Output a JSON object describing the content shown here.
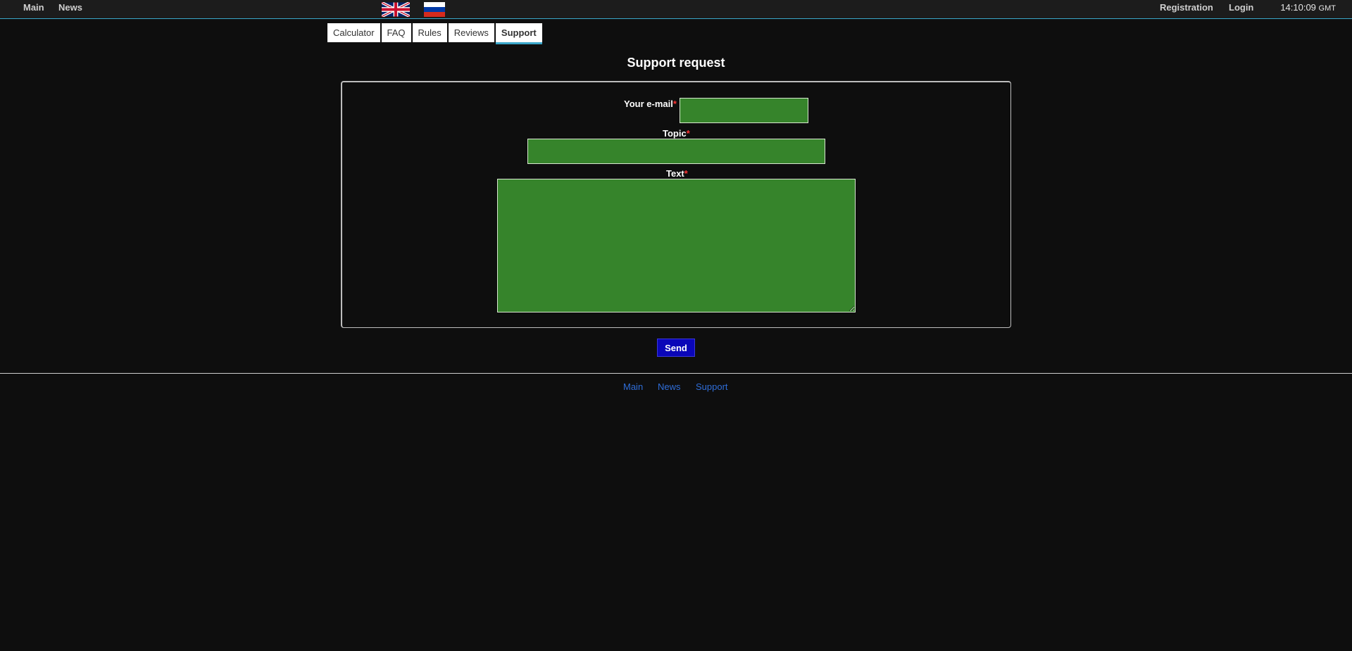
{
  "topnav": {
    "main_label": "Main",
    "news_label": "News",
    "registration_label": "Registration",
    "login_label": "Login"
  },
  "languages": [
    {
      "icon": "uk-flag-icon"
    },
    {
      "icon": "russia-flag-icon"
    }
  ],
  "clock": {
    "time": "14:10:09",
    "zone": "GMT"
  },
  "tabs": [
    {
      "label": "Calculator",
      "active": false
    },
    {
      "label": "FAQ",
      "active": false
    },
    {
      "label": "Rules",
      "active": false
    },
    {
      "label": "Reviews",
      "active": false
    },
    {
      "label": "Support",
      "active": true
    }
  ],
  "page": {
    "title": "Support request"
  },
  "form": {
    "email_label": "Your e-mail",
    "email_value": "",
    "topic_label": "Topic",
    "topic_value": "",
    "text_label": "Text",
    "text_value": "",
    "required_marker": "*",
    "send_label": "Send"
  },
  "footer": {
    "main_label": "Main",
    "news_label": "News",
    "support_label": "Support"
  },
  "colors": {
    "background": "#0e0e0e",
    "input_green": "#36842b",
    "send_blue": "#0a06b8",
    "accent_teal": "#3aa6c9",
    "footer_link": "#2f6dd8"
  }
}
